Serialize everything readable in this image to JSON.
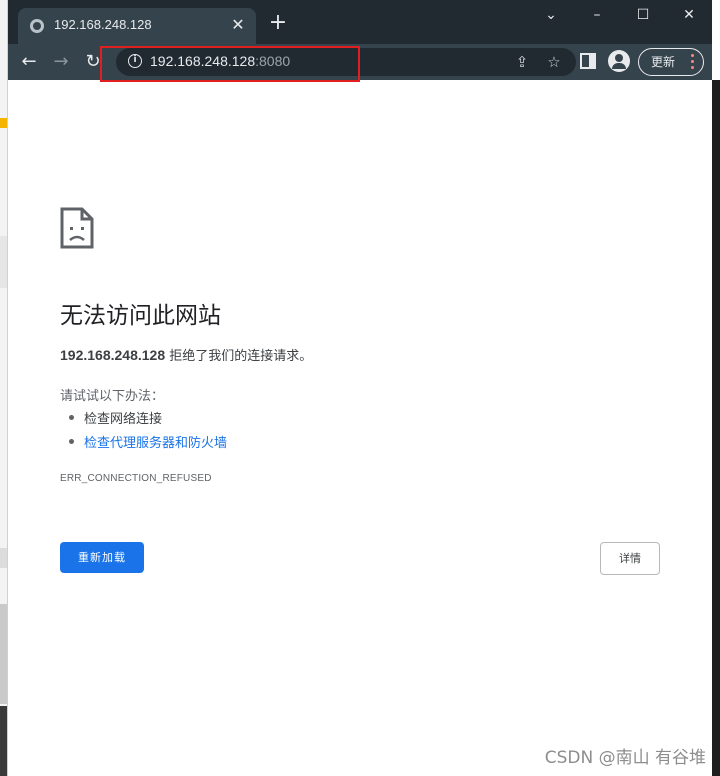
{
  "tab": {
    "title": "192.168.248.128",
    "close_icon": "close-icon",
    "favicon": "globe-icon"
  },
  "window_controls": {
    "minimize": "–",
    "maximize": "☐",
    "close": "✕",
    "dropdown": "⌄",
    "new_tab": "+"
  },
  "toolbar": {
    "back": "←",
    "forward": "→",
    "reload": "↻",
    "share": "⇪",
    "bookmark": "☆",
    "update_label": "更新"
  },
  "omnibox": {
    "host": "192.168.248.128",
    "port": ":8080"
  },
  "error_page": {
    "title": "无法访问此网站",
    "host": "192.168.248.128",
    "description_suffix": " 拒绝了我们的连接请求。",
    "try_label": "请试试以下办法：",
    "suggestions": [
      "检查网络连接",
      "检查代理服务器和防火墙"
    ],
    "error_code": "ERR_CONNECTION_REFUSED",
    "reload_label": "重新加载",
    "details_label": "详情"
  },
  "watermark": "CSDN @南山 有谷堆",
  "colors": {
    "accent": "#1a73e8",
    "highlight_box": "#e02020",
    "toolbar": "#35444c",
    "titlebar": "#202a30"
  }
}
